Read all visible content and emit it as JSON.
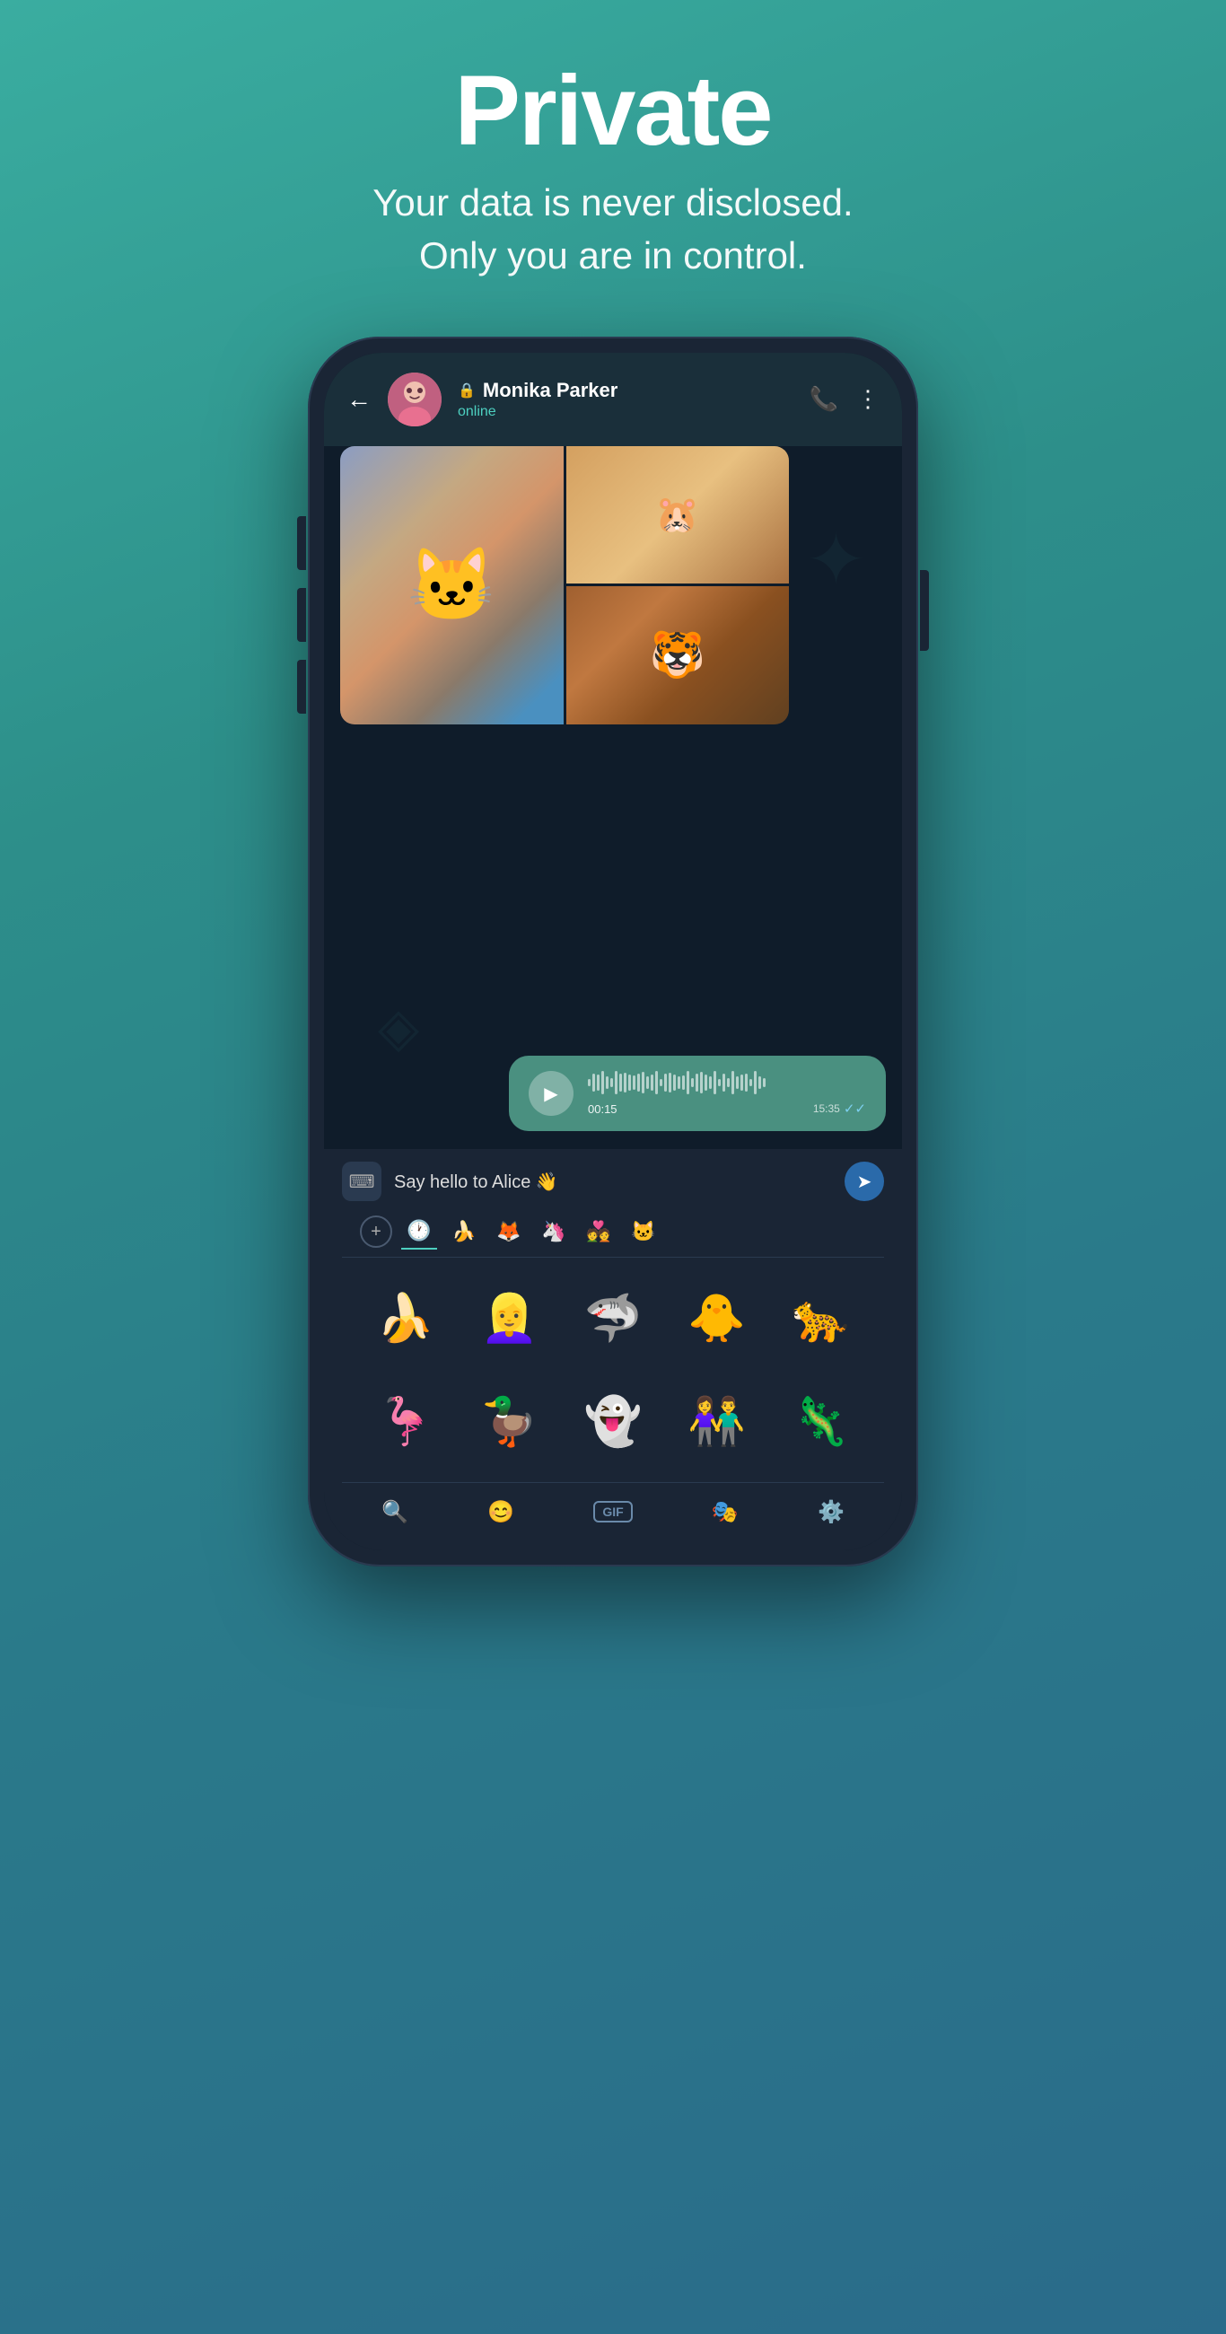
{
  "header": {
    "title": "Private",
    "subtitle_line1": "Your data is never disclosed.",
    "subtitle_line2": "Only you are in control."
  },
  "chat": {
    "contact_name": "Monika Parker",
    "contact_status": "online",
    "back_label": "←",
    "voice_duration": "00:15",
    "voice_timestamp": "15:35",
    "message_placeholder": "Say hello to Alice 👋",
    "send_label": "➤"
  },
  "sticker_tabs": [
    {
      "id": "recent",
      "icon": "🕐",
      "active": true
    },
    {
      "id": "pack1",
      "icon": "🍌",
      "active": false
    },
    {
      "id": "pack2",
      "icon": "🦊",
      "active": false
    },
    {
      "id": "pack3",
      "icon": "🦄",
      "active": false
    },
    {
      "id": "pack4",
      "icon": "💑",
      "active": false
    },
    {
      "id": "pack5",
      "icon": "🐱",
      "active": false
    }
  ],
  "stickers_row1": [
    "🍌",
    "👱‍♀️",
    "🦈",
    "🐥",
    "🐆"
  ],
  "stickers_row2": [
    "🦩",
    "🦆",
    "👻",
    "👫",
    "🦎"
  ],
  "bottom_tools": [
    {
      "id": "search",
      "icon": "🔍"
    },
    {
      "id": "emoji",
      "icon": "😊"
    },
    {
      "id": "gif",
      "icon": "GIF"
    },
    {
      "id": "stickers",
      "icon": "🎭"
    },
    {
      "id": "settings",
      "icon": "⚙️"
    }
  ],
  "colors": {
    "accent": "#4dd0c0",
    "bg_gradient_start": "#3aada0",
    "bg_gradient_end": "#2a6b8a",
    "chat_bubble": "#4a9080",
    "send_btn": "#2a6aaa"
  }
}
